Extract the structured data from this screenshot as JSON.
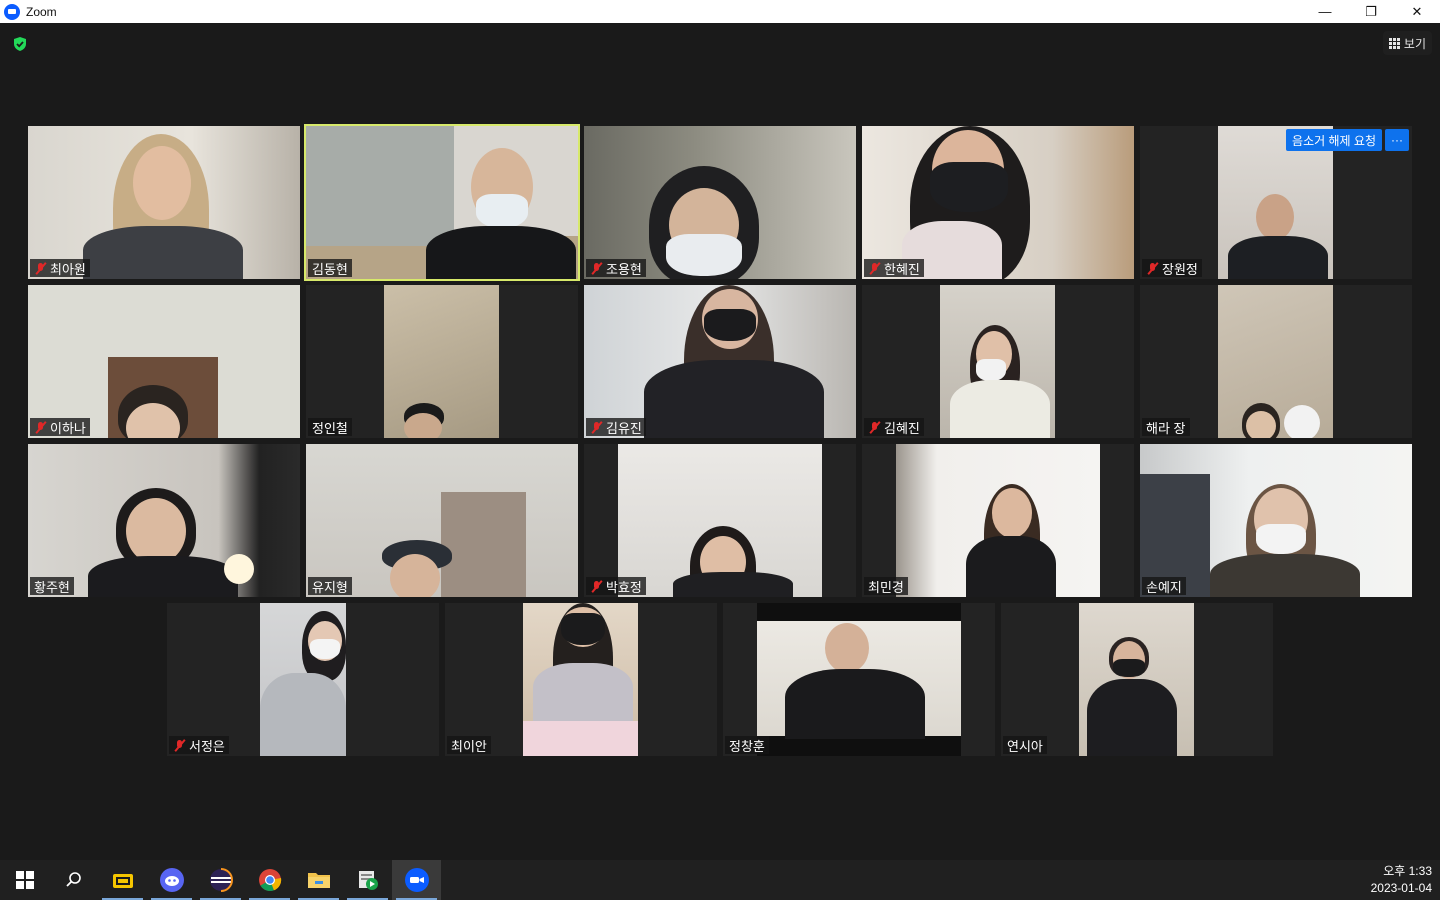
{
  "window": {
    "title": "Zoom",
    "minimize": "—",
    "restore": "❐",
    "close": "✕"
  },
  "toolbar": {
    "view_label": "보기"
  },
  "unmute_request": {
    "label": "음소거 해제 요청",
    "more": "···"
  },
  "participants": [
    {
      "name": "최아원",
      "muted": true
    },
    {
      "name": "김동현",
      "muted": false,
      "active_speaker": true
    },
    {
      "name": "조용현",
      "muted": true
    },
    {
      "name": "한혜진",
      "muted": true
    },
    {
      "name": "장원정",
      "muted": true
    },
    {
      "name": "이하나",
      "muted": true
    },
    {
      "name": "정인철",
      "muted": false
    },
    {
      "name": "김유진",
      "muted": true
    },
    {
      "name": "김혜진",
      "muted": true
    },
    {
      "name": "해라 장",
      "muted": false
    },
    {
      "name": "황주현",
      "muted": false
    },
    {
      "name": "유지형",
      "muted": false
    },
    {
      "name": "박효정",
      "muted": true
    },
    {
      "name": "최민경",
      "muted": false
    },
    {
      "name": "손예지",
      "muted": false
    },
    {
      "name": "서정은",
      "muted": true
    },
    {
      "name": "최이안",
      "muted": false
    },
    {
      "name": "정창훈",
      "muted": false
    },
    {
      "name": "연시아",
      "muted": false
    }
  ],
  "taskbar": {
    "apps": [
      "start-icon",
      "search-icon",
      "pdf-app-icon",
      "discord-icon",
      "eclipse-icon",
      "chrome-icon",
      "file-explorer-icon",
      "media-player-icon",
      "zoom-icon"
    ],
    "time": "오후 1:33",
    "date": "2023-01-04"
  },
  "colors": {
    "active_speaker": "#d7e96a",
    "muted": "#e02828",
    "accent": "#0e72ed"
  }
}
